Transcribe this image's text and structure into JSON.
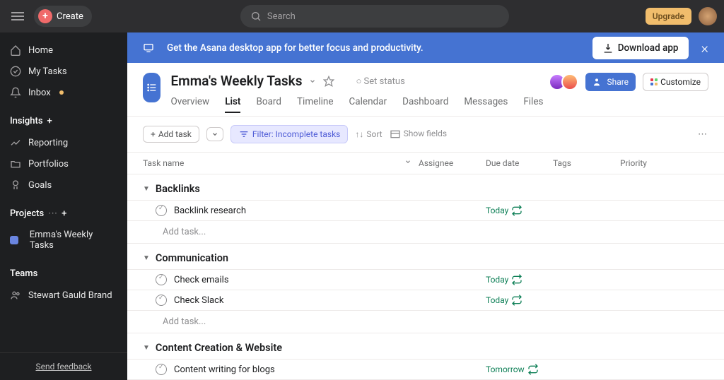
{
  "topbar": {
    "create": "Create",
    "search_placeholder": "Search",
    "upgrade": "Upgrade"
  },
  "sidebar": {
    "nav": {
      "home": "Home",
      "mytasks": "My Tasks",
      "inbox": "Inbox"
    },
    "sections": {
      "insights": "Insights",
      "reporting": "Reporting",
      "portfolios": "Portfolios",
      "goals": "Goals",
      "projects": "Projects",
      "project_name": "Emma's Weekly Tasks",
      "teams": "Teams",
      "team_name": "Stewart Gauld Brand"
    },
    "feedback": "Send feedback"
  },
  "banner": {
    "text": "Get the Asana desktop app for better focus and productivity.",
    "download": "Download app"
  },
  "project": {
    "title": "Emma's Weekly Tasks",
    "set_status": "Set status",
    "share": "Share",
    "customize": "Customize",
    "tabs": {
      "overview": "Overview",
      "list": "List",
      "board": "Board",
      "timeline": "Timeline",
      "calendar": "Calendar",
      "dashboard": "Dashboard",
      "messages": "Messages",
      "files": "Files"
    }
  },
  "toolbar": {
    "add_task": "Add task",
    "filter": "Filter: Incomplete tasks",
    "sort": "Sort",
    "show_fields": "Show fields"
  },
  "columns": {
    "task": "Task name",
    "assignee": "Assignee",
    "due": "Due date",
    "tags": "Tags",
    "priority": "Priority"
  },
  "sections_data": {
    "s1": {
      "title": "Backlinks",
      "add": "Add task...",
      "t1": {
        "name": "Backlink research",
        "due": "Today"
      }
    },
    "s2": {
      "title": "Communication",
      "add": "Add task...",
      "t1": {
        "name": "Check emails",
        "due": "Today"
      },
      "t2": {
        "name": "Check Slack",
        "due": "Today"
      }
    },
    "s3": {
      "title": "Content Creation & Website",
      "t1": {
        "name": "Content writing for blogs",
        "due": "Tomorrow"
      }
    }
  }
}
